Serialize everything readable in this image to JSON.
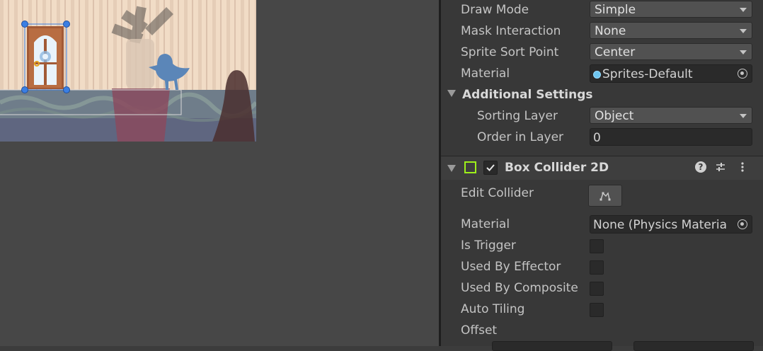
{
  "inspector": {
    "draw_mode": {
      "label": "Draw Mode",
      "value": "Simple"
    },
    "mask_interaction": {
      "label": "Mask Interaction",
      "value": "None"
    },
    "sprite_sort_point": {
      "label": "Sprite Sort Point",
      "value": "Center"
    },
    "material": {
      "label": "Material",
      "value": "Sprites-Default"
    },
    "additional_settings": {
      "label": "Additional Settings"
    },
    "sorting_layer": {
      "label": "Sorting Layer",
      "value": "Object"
    },
    "order_in_layer": {
      "label": "Order in Layer",
      "value": "0"
    },
    "box_collider": {
      "title": "Box Collider 2D",
      "enabled": true,
      "edit_collider_label": "Edit Collider",
      "material_label": "Material",
      "material_value": "None (Physics Materia",
      "is_trigger_label": "Is Trigger",
      "used_by_effector_label": "Used By Effector",
      "used_by_composite_label": "Used By Composite",
      "auto_tiling_label": "Auto Tiling",
      "offset_label": "Offset",
      "is_trigger": false,
      "used_by_effector": false,
      "used_by_composite": false,
      "auto_tiling": false
    }
  },
  "icons": {
    "help": "help-icon",
    "presets": "presets-icon",
    "menu": "kebab-menu-icon",
    "edit_collider": "edit-collider-icon",
    "object_picker": "object-picker-icon"
  },
  "colors": {
    "collider_icon": "#9ef01a",
    "selection_handle": "#3b7fe3"
  }
}
